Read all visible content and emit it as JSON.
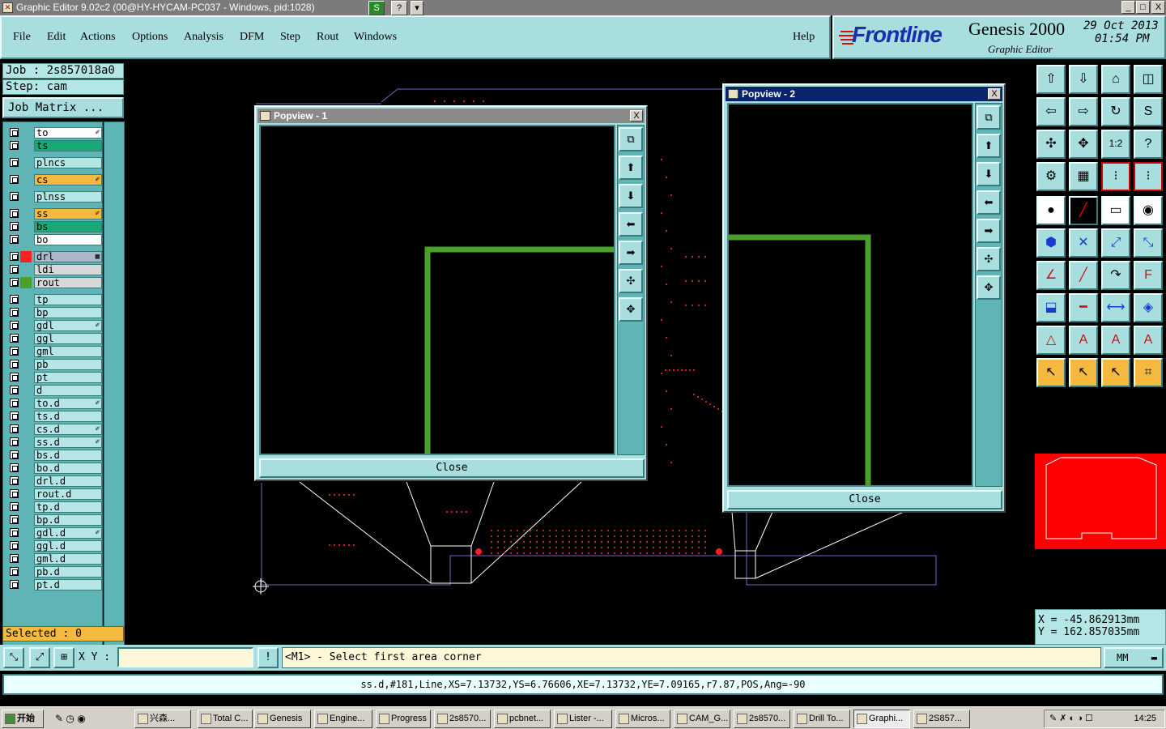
{
  "window": {
    "title": "Graphic Editor 9.02c2 (00@HY-HYCAM-PC037 - Windows, pid:1028)",
    "extra_btn1": "S",
    "extra_btn2": "?",
    "minimize": "_",
    "maximize": "□",
    "close": "X"
  },
  "menu": {
    "items": [
      "File",
      "Edit",
      "Actions",
      "Options",
      "Analysis",
      "DFM",
      "Step",
      "Rout",
      "Windows"
    ],
    "help": "Help"
  },
  "brand": {
    "logo": "Frontline",
    "product": "Genesis 2000",
    "subtitle": "Graphic Editor",
    "date": "29 Oct 2013",
    "time": "01:54 PM"
  },
  "job": {
    "job_label": "Job : 2s857018a0",
    "step_label": "Step: cam",
    "matrix_button": "Job Matrix ..."
  },
  "layers": [
    {
      "name": "to",
      "color": "#ffffff",
      "tag": "✐"
    },
    {
      "name": "ts",
      "color": "#1aa878",
      "tag": ""
    },
    {
      "name": "plncs",
      "color": "#b4e6e6",
      "tag": ""
    },
    {
      "name": "cs",
      "color": "#f5b940",
      "tag": "✐"
    },
    {
      "name": "plnss",
      "color": "#b4e6e6",
      "tag": ""
    },
    {
      "name": "ss",
      "color": "#f5b940",
      "tag": "✐"
    },
    {
      "name": "bs",
      "color": "#1aa878",
      "tag": ""
    },
    {
      "name": "bo",
      "color": "#ffffff",
      "tag": ""
    },
    {
      "name": "drl",
      "color": "#aab8c8",
      "tag": "▦",
      "swatch": "#ff2020"
    },
    {
      "name": "ldi",
      "color": "#d8d8d8",
      "tag": ""
    },
    {
      "name": "rout",
      "color": "#d8d8d8",
      "tag": "",
      "swatch": "#4aa02a"
    },
    {
      "name": "tp",
      "color": "#b4e6e6",
      "tag": ""
    },
    {
      "name": "bp",
      "color": "#b4e6e6",
      "tag": ""
    },
    {
      "name": "gdl",
      "color": "#b4e6e6",
      "tag": "✐"
    },
    {
      "name": "ggl",
      "color": "#b4e6e6",
      "tag": ""
    },
    {
      "name": "gml",
      "color": "#b4e6e6",
      "tag": ""
    },
    {
      "name": "pb",
      "color": "#b4e6e6",
      "tag": ""
    },
    {
      "name": "pt",
      "color": "#b4e6e6",
      "tag": ""
    },
    {
      "name": "d",
      "color": "#b4e6e6",
      "tag": ""
    },
    {
      "name": "to.d",
      "color": "#b4e6e6",
      "tag": "✐"
    },
    {
      "name": "ts.d",
      "color": "#b4e6e6",
      "tag": ""
    },
    {
      "name": "cs.d",
      "color": "#b4e6e6",
      "tag": "✐"
    },
    {
      "name": "ss.d",
      "color": "#b4e6e6",
      "tag": "✐"
    },
    {
      "name": "bs.d",
      "color": "#b4e6e6",
      "tag": ""
    },
    {
      "name": "bo.d",
      "color": "#b4e6e6",
      "tag": ""
    },
    {
      "name": "drl.d",
      "color": "#b4e6e6",
      "tag": ""
    },
    {
      "name": "rout.d",
      "color": "#b4e6e6",
      "tag": ""
    },
    {
      "name": "tp.d",
      "color": "#b4e6e6",
      "tag": ""
    },
    {
      "name": "bp.d",
      "color": "#b4e6e6",
      "tag": ""
    },
    {
      "name": "gdl.d",
      "color": "#b4e6e6",
      "tag": "✐"
    },
    {
      "name": "ggl.d",
      "color": "#b4e6e6",
      "tag": ""
    },
    {
      "name": "gml.d",
      "color": "#b4e6e6",
      "tag": ""
    },
    {
      "name": "pb.d",
      "color": "#b4e6e6",
      "tag": ""
    },
    {
      "name": "pt.d",
      "color": "#b4e6e6",
      "tag": ""
    }
  ],
  "selected": "Selected : 0",
  "popview1": {
    "title": "Popview - 1",
    "close_button": "Close",
    "x_button": "X"
  },
  "popview2": {
    "title": "Popview - 2",
    "close_button": "Close",
    "x_button": "X"
  },
  "coords": {
    "x": "X = -45.862913mm",
    "y": "Y = 162.857035mm"
  },
  "command": {
    "xy_label": "X Y :",
    "xy_value": "",
    "alert": "!",
    "prompt": "<M1> - Select first area corner",
    "units": "MM"
  },
  "status": "ss.d,#181,Line,XS=7.13732,YS=6.76606,XE=7.13732,YE=7.09165,r7.87,POS,Ang=-90",
  "taskbar": {
    "start": "开始",
    "tasks": [
      "兴森...",
      "Total C...",
      "Genesis",
      "Engine...",
      "Progress",
      "2s8570...",
      "pcbnet...",
      "Lister -...",
      "Micros...",
      "CAM_G...",
      "2s8570...",
      "Drill To...",
      "Graphi...",
      "2S857..."
    ],
    "clock": "14:25"
  }
}
